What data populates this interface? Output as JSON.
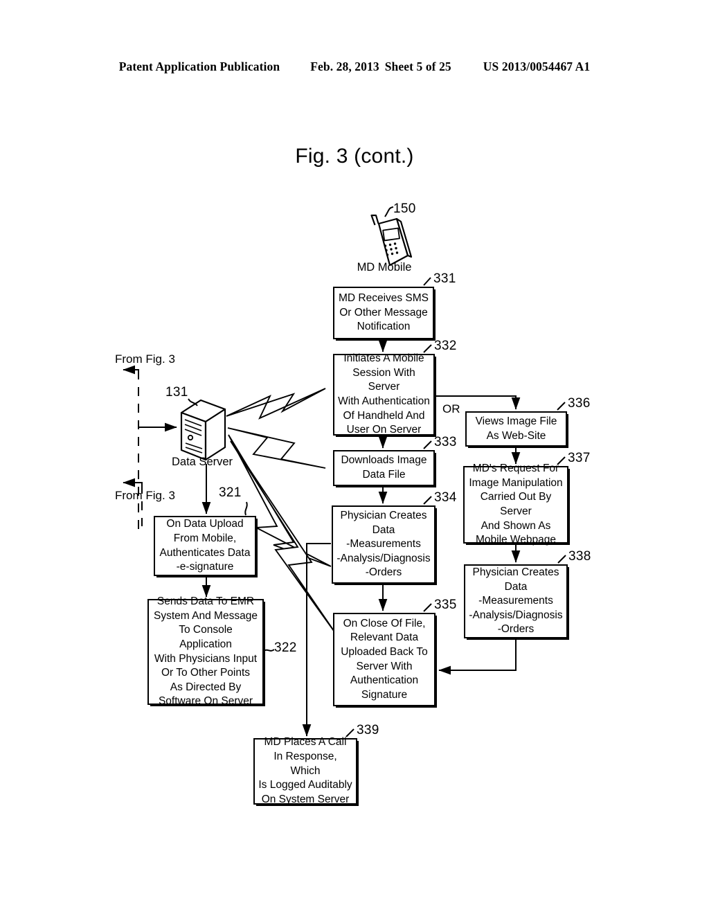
{
  "header": {
    "publication": "Patent Application Publication",
    "date": "Feb. 28, 2013",
    "sheet": "Sheet 5 of 25",
    "patent_number": "US 2013/0054467 A1"
  },
  "figure": {
    "title": "Fig. 3 (cont.)"
  },
  "labels": {
    "md_mobile": "MD Mobile",
    "data_server": "Data Server",
    "or": "OR",
    "from_fig_3_top": "From Fig. 3",
    "from_fig_3_bottom": "From Fig. 3"
  },
  "refnums": {
    "mobile": "150",
    "server": "131",
    "n331": "331",
    "n332": "332",
    "n333": "333",
    "n334": "334",
    "n335": "335",
    "n336": "336",
    "n337": "337",
    "n338": "338",
    "n339": "339",
    "n321": "321",
    "n322": "322"
  },
  "nodes": {
    "n331": "MD Receives SMS\nOr Other Message\nNotification",
    "n332": "Initiates A Mobile\nSession With Server\nWith Authentication\nOf Handheld And\nUser On Server",
    "n333": "Downloads Image\nData File",
    "n334": "Physician Creates\nData\n-Measurements\n-Analysis/Diagnosis\n-Orders",
    "n335": "On Close Of File,\nRelevant Data\nUploaded Back To\nServer With\nAuthentication\nSignature",
    "n336": "Views Image File\nAs Web-Site",
    "n337": "MD's Request For\nImage Manipulation\nCarried Out By Server\nAnd Shown As\nMobile Webpage",
    "n338": "Physician Creates\nData\n-Measurements\n-Analysis/Diagnosis\n-Orders",
    "n339": "MD Places A Call\nIn Response, Which\nIs Logged Auditably\nOn System Server",
    "n321": "On Data Upload\nFrom Mobile,\nAuthenticates Data\n-e-signature",
    "n322": "Sends Data To EMR\nSystem And Message\nTo Console Application\nWith Physicians Input\nOr To Other Points\nAs Directed By\nSoftware On Server"
  },
  "icons": {
    "mobile_phone": "mobile-phone-icon",
    "server_tower": "server-tower-icon"
  },
  "colors": {
    "ink": "#000000",
    "paper": "#ffffff"
  }
}
